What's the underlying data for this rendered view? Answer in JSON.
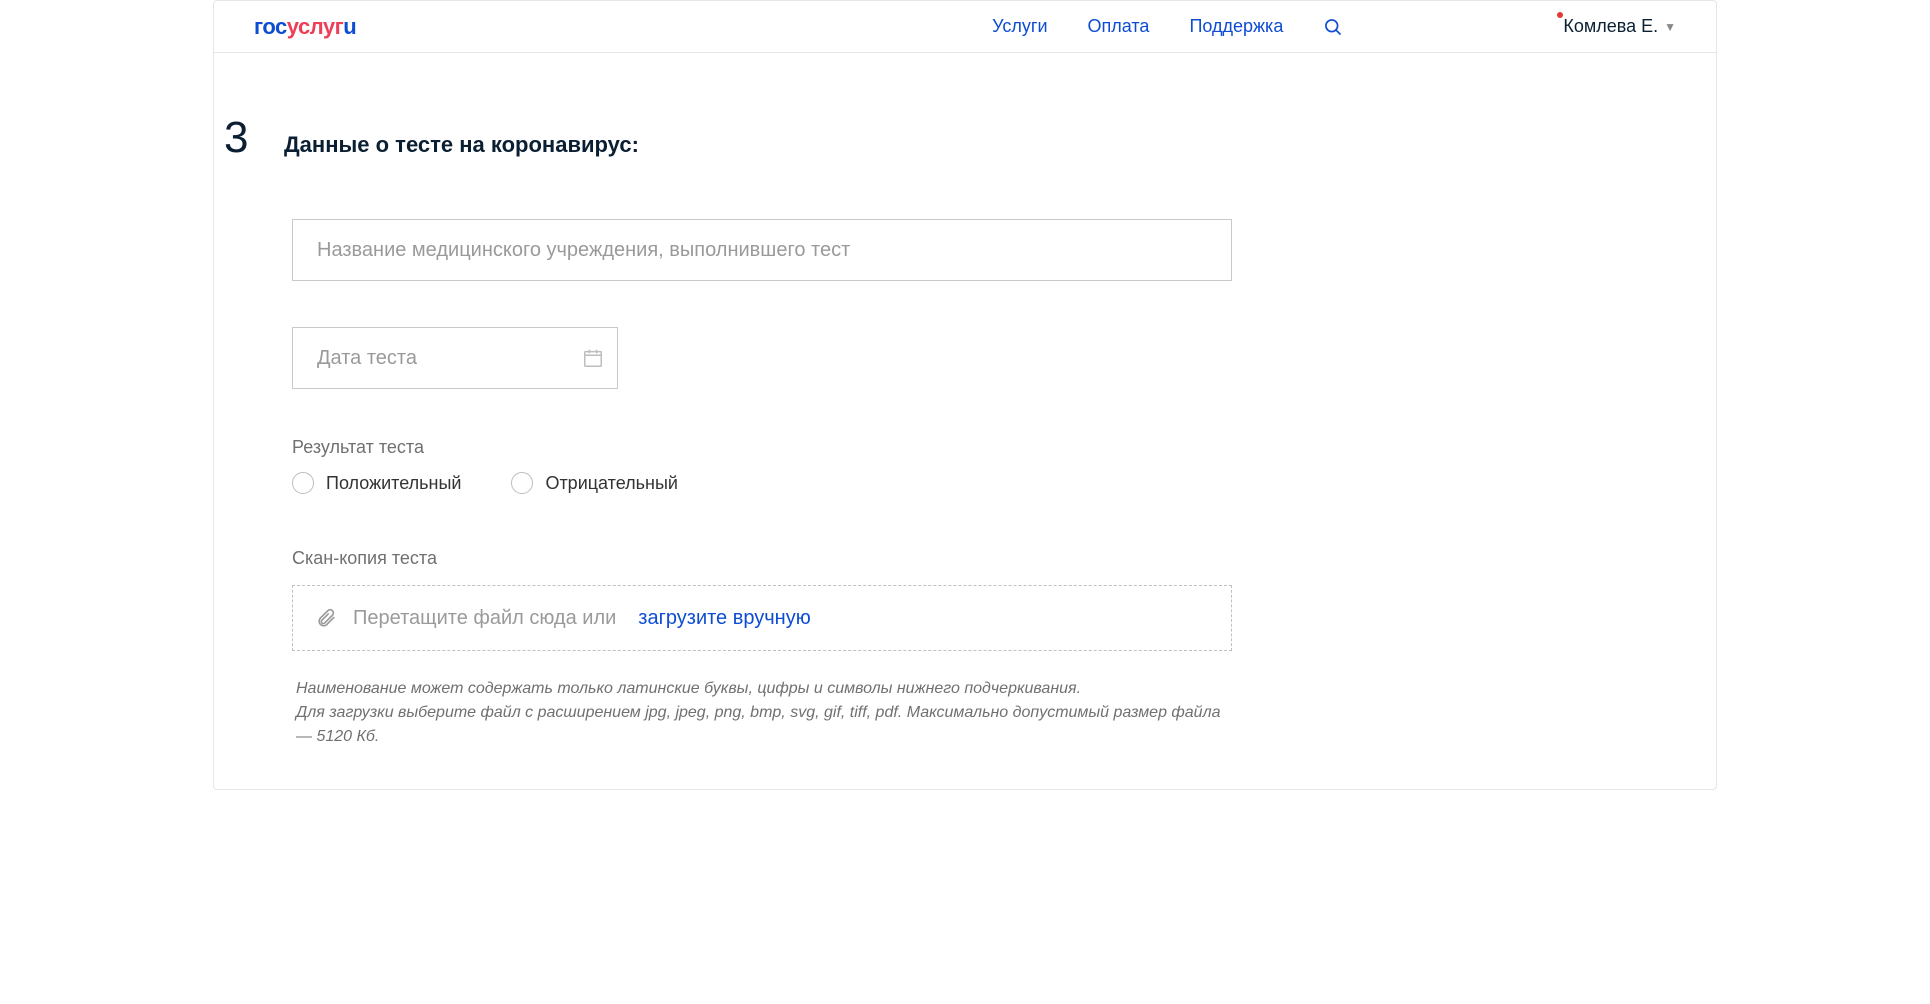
{
  "header": {
    "logo": {
      "part1": "гос",
      "part2": "услуг",
      "part3": "u"
    },
    "nav": {
      "services": "Услуги",
      "payment": "Оплата",
      "support": "Поддержка"
    },
    "user_name": "Комлева Е."
  },
  "step": {
    "number": "3",
    "title": "Данные о тесте на коронавирус:"
  },
  "form": {
    "institution_placeholder": "Название медицинского учреждения, выполнившего тест",
    "date_placeholder": "Дата теста",
    "result_label": "Результат теста",
    "result_positive": "Положительный",
    "result_negative": "Отрицательный",
    "scan_label": "Скан-копия теста",
    "dropzone_text": "Перетащите файл сюда или",
    "dropzone_link": "загрузите вручную",
    "hint_line1": "Наименование может содержать только латинские буквы, цифры и символы нижнего подчеркивания.",
    "hint_line2": "Для загрузки выберите файл с расширением jpg, jpeg, png, bmp, svg, gif, tiff, pdf. Максимально допустимый размер файла — 5120 Кб."
  }
}
